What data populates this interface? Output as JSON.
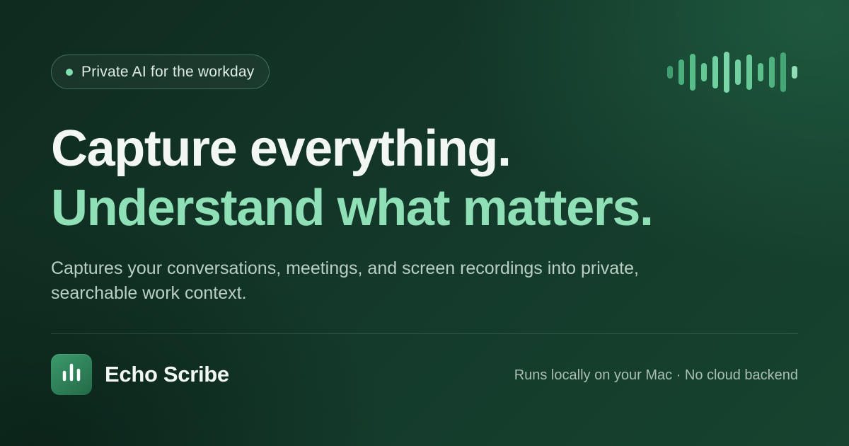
{
  "badge": {
    "label": "Private AI for the workday"
  },
  "headline": {
    "line1": "Capture everything.",
    "line2": "Understand what matters."
  },
  "subtitle": "Captures your conversations, meetings, and screen recordings into private, searchable work context.",
  "footer": {
    "brand_name": "Echo Scribe",
    "note": "Runs locally on your Mac · No cloud backend"
  },
  "icons": {
    "badge": "status-dot-icon",
    "decoration": "audio-waveform-icon",
    "logo": "bar-chart-logo-icon"
  },
  "colors": {
    "background": "#143a2b",
    "headline_primary": "#f3f7f3",
    "headline_accent": "#8fe0b6",
    "accent": "#7fe0b0",
    "subtitle": "#b9cfc3",
    "logo": "#3c9a6c"
  }
}
